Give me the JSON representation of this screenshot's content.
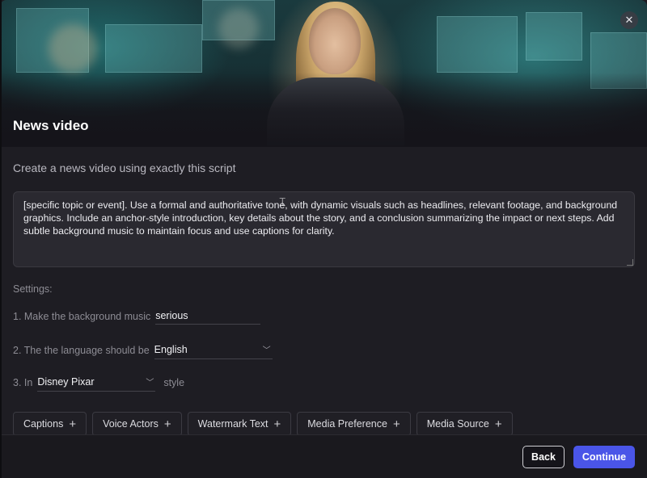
{
  "modal": {
    "title": "News video",
    "close_icon": "close-icon",
    "subtitle": "Create a news video using exactly this script"
  },
  "script": {
    "value": "[specific topic or event]. Use a formal and authoritative tone, with dynamic visuals such as headlines, relevant footage, and background graphics. Include an anchor-style introduction, key details about the story, and a conclusion summarizing the impact or next steps. Add subtle background music to maintain focus and use captions for clarity."
  },
  "settings": {
    "label": "Settings:",
    "music": {
      "prefix": "1. Make the background music",
      "value": "serious"
    },
    "language": {
      "prefix": "2. The the language should be",
      "value": "English"
    },
    "style": {
      "prefix": "3. In",
      "value": "Disney Pixar",
      "suffix": "style"
    }
  },
  "chips": [
    {
      "label": "Captions"
    },
    {
      "label": "Voice Actors"
    },
    {
      "label": "Watermark Text"
    },
    {
      "label": "Media Preference"
    },
    {
      "label": "Media Source"
    }
  ],
  "footer": {
    "back_label": "Back",
    "continue_label": "Continue"
  },
  "colors": {
    "accent": "#4a55e8",
    "background": "#1e1d23"
  }
}
